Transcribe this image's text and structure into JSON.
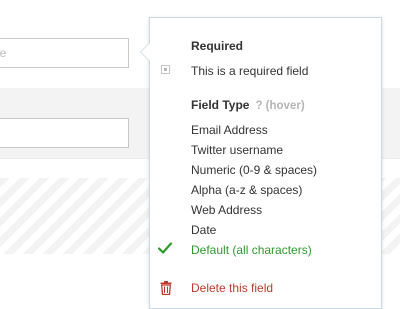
{
  "background": {
    "input_1_placeholder": "ere",
    "input_2_value": ""
  },
  "popover": {
    "required": {
      "title": "Required",
      "checkbox_label": "This is a required field",
      "checked": false
    },
    "field_type": {
      "title": "Field Type",
      "hint": "? (hover)",
      "options": [
        {
          "label": "Email Address",
          "selected": false
        },
        {
          "label": "Twitter username",
          "selected": false
        },
        {
          "label": "Numeric (0-9 & spaces)",
          "selected": false
        },
        {
          "label": "Alpha (a-z & spaces)",
          "selected": false
        },
        {
          "label": "Web Address",
          "selected": false
        },
        {
          "label": "Date",
          "selected": false
        },
        {
          "label": "Default (all characters)",
          "selected": true
        }
      ]
    },
    "delete_label": "Delete this field"
  },
  "colors": {
    "selected": "#2e9a2e",
    "danger": "#c0392b",
    "hint": "#b5b5b5",
    "popover_border": "#c9d7e6"
  },
  "icons": {
    "selected": "check-icon",
    "delete": "trash-icon",
    "checkbox": "checkbox-icon"
  }
}
